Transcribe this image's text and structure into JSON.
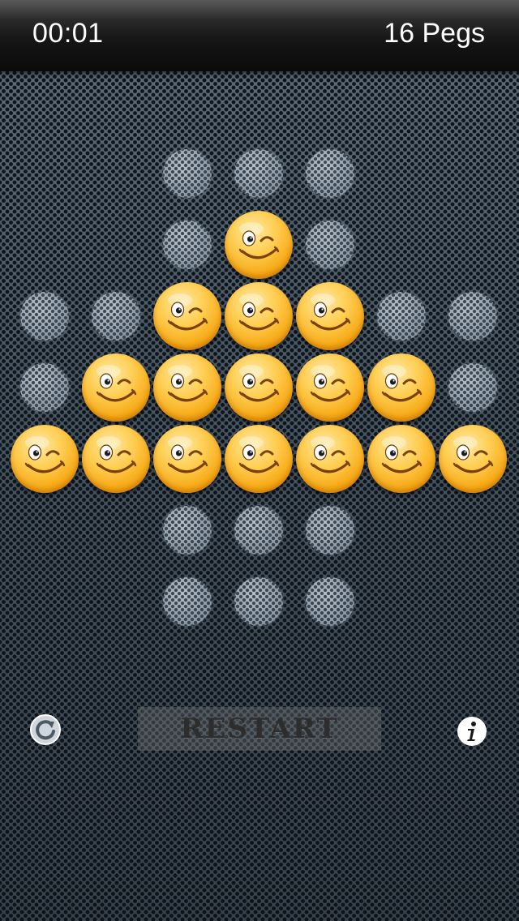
{
  "status_bar": {
    "timer": "00:01",
    "pegs_count": "16 Pegs"
  },
  "board": {
    "layout": "cross-shaped peg solitaire board (33 holes)",
    "pegs_remaining": 16,
    "rows": [
      [
        null,
        null,
        0,
        0,
        0,
        null,
        null
      ],
      [
        null,
        null,
        0,
        1,
        0,
        null,
        null
      ],
      [
        0,
        0,
        1,
        1,
        1,
        0,
        0
      ],
      [
        0,
        1,
        1,
        1,
        1,
        1,
        0
      ],
      [
        1,
        1,
        1,
        1,
        1,
        1,
        1
      ],
      [
        null,
        null,
        0,
        0,
        0,
        null,
        null
      ],
      [
        null,
        null,
        0,
        0,
        0,
        null,
        null
      ]
    ],
    "peg_icon": "winking-smiley-face"
  },
  "controls": {
    "restart_label": "RESTART",
    "left_icon": "refresh-icon",
    "right_icon": "info-icon"
  },
  "colors": {
    "background": "#4a5866",
    "topbar": "#111111",
    "peg": "#f6a915",
    "hole": "#9aa7b3",
    "restart_text": "#2d2d2d"
  }
}
